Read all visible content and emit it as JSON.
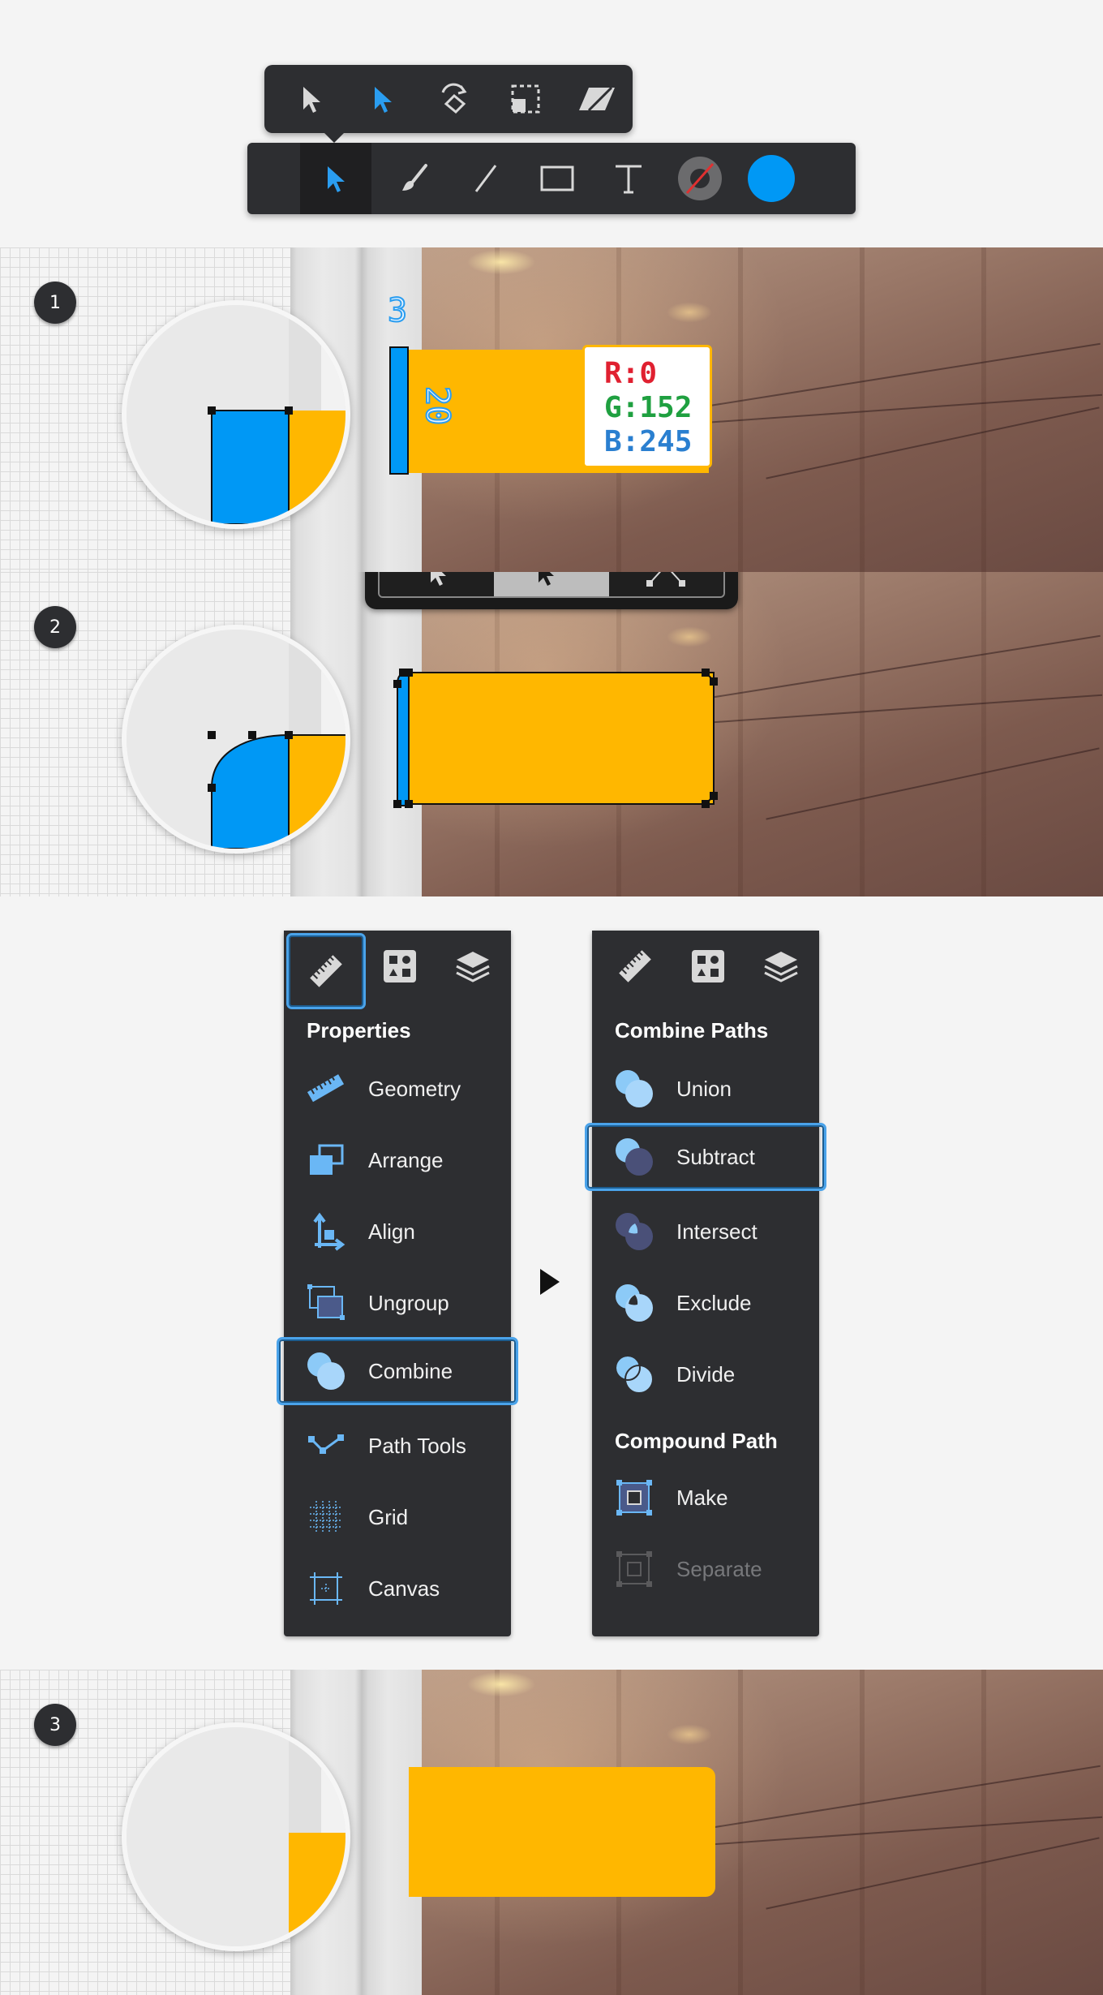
{
  "toolbar": {
    "subtools": [
      "Move Tool",
      "Node Tool",
      "Rotate Tool",
      "Crop Tool",
      "Shear Tool"
    ],
    "tools": [
      "Select Tool",
      "Brush Tool",
      "Line Tool",
      "Rectangle Tool",
      "Text Tool",
      "Stroke Color",
      "Fill Color"
    ],
    "fill_color": "#0098f5",
    "stroke": "none"
  },
  "steps": [
    "1",
    "2",
    "3"
  ],
  "annotations": {
    "width_label": "3",
    "height_label": "20",
    "color_r": "R:0",
    "color_g": "G:152",
    "color_b": "B:245",
    "accent_yellow": "#ffb700",
    "accent_blue": "#0098f5"
  },
  "node_toolbar": {
    "buttons": [
      "Select",
      "Add Node",
      "Convert Node"
    ],
    "active": "Add Node"
  },
  "left_panel": {
    "title": "Properties",
    "tabs": [
      "ruler-icon",
      "shapes-icon",
      "layers-icon"
    ],
    "items": [
      {
        "label": "Geometry",
        "icon": "ruler-icon"
      },
      {
        "label": "Arrange",
        "icon": "arrange-icon"
      },
      {
        "label": "Align",
        "icon": "align-icon"
      },
      {
        "label": "Ungroup",
        "icon": "ungroup-icon"
      },
      {
        "label": "Combine",
        "icon": "combine-icon",
        "selected": true
      },
      {
        "label": "Path Tools",
        "icon": "path-tools-icon"
      },
      {
        "label": "Grid",
        "icon": "grid-icon"
      },
      {
        "label": "Canvas",
        "icon": "canvas-icon"
      }
    ]
  },
  "right_panel": {
    "title": "Combine Paths",
    "items": [
      {
        "label": "Union",
        "icon": "union-icon"
      },
      {
        "label": "Subtract",
        "icon": "subtract-icon",
        "selected": true
      },
      {
        "label": "Intersect",
        "icon": "intersect-icon"
      },
      {
        "label": "Exclude",
        "icon": "exclude-icon"
      },
      {
        "label": "Divide",
        "icon": "divide-icon"
      }
    ],
    "section2_title": "Compound Path",
    "items2": [
      {
        "label": "Make",
        "icon": "make-icon"
      },
      {
        "label": "Separate",
        "icon": "separate-icon",
        "disabled": true
      }
    ]
  }
}
